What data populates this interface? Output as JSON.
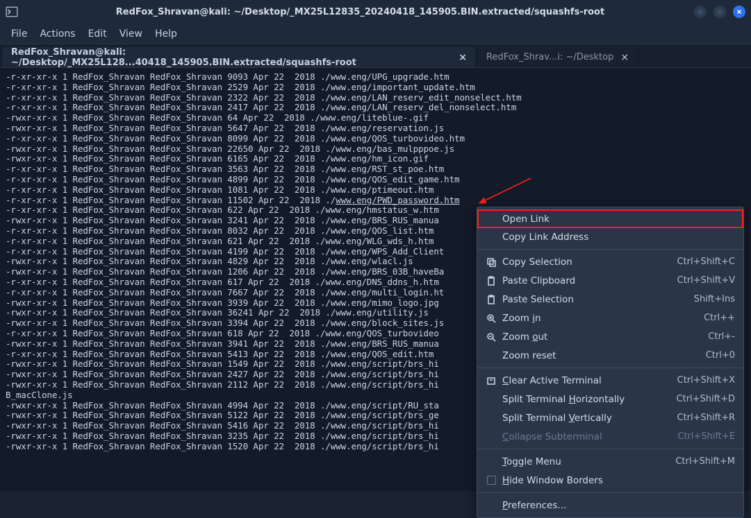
{
  "titlebar": {
    "title": "RedFox_Shravan@kali: ~/Desktop/_MX25L12835_20240418_145905.BIN.extracted/squashfs-root"
  },
  "menubar": {
    "file": "File",
    "actions": "Actions",
    "edit": "Edit",
    "view": "View",
    "help": "Help"
  },
  "tabs": [
    {
      "label": "RedFox_Shravan@kali: ~/Desktop/_MX25L128...40418_145905.BIN.extracted/squashfs-root",
      "active": true
    },
    {
      "label": "RedFox_Shrav...i: ~/Desktop",
      "active": false
    }
  ],
  "terminal_rows": [
    "-r-xr-xr-x 1 RedFox_Shravan RedFox_Shravan 9093 Apr 22  2018 ./www.eng/UPG_upgrade.htm",
    "-r-xr-xr-x 1 RedFox_Shravan RedFox_Shravan 2529 Apr 22  2018 ./www.eng/important_update.htm",
    "-r-xr-xr-x 1 RedFox_Shravan RedFox_Shravan 2322 Apr 22  2018 ./www.eng/LAN_reserv_edit_nonselect.htm",
    "-r-xr-xr-x 1 RedFox_Shravan RedFox_Shravan 2417 Apr 22  2018 ./www.eng/LAN_reserv_del_nonselect.htm",
    "-rwxr-xr-x 1 RedFox_Shravan RedFox_Shravan 64 Apr 22  2018 ./www.eng/liteblue-.gif",
    "-rwxr-xr-x 1 RedFox_Shravan RedFox_Shravan 5647 Apr 22  2018 ./www.eng/reservation.js",
    "-r-xr-xr-x 1 RedFox_Shravan RedFox_Shravan 8099 Apr 22  2018 ./www.eng/QOS_turbovideo.htm",
    "-rwxr-xr-x 1 RedFox_Shravan RedFox_Shravan 22650 Apr 22  2018 ./www.eng/bas_mulpppoe.js",
    "-rwxr-xr-x 1 RedFox_Shravan RedFox_Shravan 6165 Apr 22  2018 ./www.eng/hm_icon.gif",
    "-r-xr-xr-x 1 RedFox_Shravan RedFox_Shravan 3563 Apr 22  2018 ./www.eng/RST_st_poe.htm",
    "-r-xr-xr-x 1 RedFox_Shravan RedFox_Shravan 4899 Apr 22  2018 ./www.eng/QOS_edit_game.htm",
    "-r-xr-xr-x 1 RedFox_Shravan RedFox_Shravan 1081 Apr 22  2018 ./www.eng/ptimeout.htm",
    "-r-xr-xr-x 1 RedFox_Shravan RedFox_Shravan 11502 Apr 22  2018 ./|UNDER|www.eng/PWD_password.htm|END|",
    "-r-xr-xr-x 1 RedFox_Shravan RedFox_Shravan 622 Apr 22  2018 ./www.eng/hmstatus_w.htm",
    "-rwxr-xr-x 1 RedFox_Shravan RedFox_Shravan 3241 Apr 22  2018 ./www.eng/BRS_RUS_manua",
    "-r-xr-xr-x 1 RedFox_Shravan RedFox_Shravan 8032 Apr 22  2018 ./www.eng/QOS_list.htm",
    "-r-xr-xr-x 1 RedFox_Shravan RedFox_Shravan 621 Apr 22  2018 ./www.eng/WLG_wds_h.htm",
    "-r-xr-xr-x 1 RedFox_Shravan RedFox_Shravan 4199 Apr 22  2018 ./www.eng/WPS_Add_Client",
    "-rwxr-xr-x 1 RedFox_Shravan RedFox_Shravan 4829 Apr 22  2018 ./www.eng/wlacl.js",
    "-rwxr-xr-x 1 RedFox_Shravan RedFox_Shravan 1206 Apr 22  2018 ./www.eng/BRS_03B_haveBa",
    "-r-xr-xr-x 1 RedFox_Shravan RedFox_Shravan 617 Apr 22  2018 ./www.eng/DNS_ddns_h.htm",
    "-r-xr-xr-x 1 RedFox_Shravan RedFox_Shravan 7667 Apr 22  2018 ./www.eng/multi_login.ht",
    "-rwxr-xr-x 1 RedFox_Shravan RedFox_Shravan 3939 Apr 22  2018 ./www.eng/mimo_logo.jpg",
    "-rwxr-xr-x 1 RedFox_Shravan RedFox_Shravan 36241 Apr 22  2018 ./www.eng/utility.js",
    "-rwxr-xr-x 1 RedFox_Shravan RedFox_Shravan 3394 Apr 22  2018 ./www.eng/block_sites.js",
    "-r-xr-xr-x 1 RedFox_Shravan RedFox_Shravan 618 Apr 22  2018 ./www.eng/QOS_turbovideo",
    "-rwxr-xr-x 1 RedFox_Shravan RedFox_Shravan 3941 Apr 22  2018 ./www.eng/BRS_RUS_manua",
    "-r-xr-xr-x 1 RedFox_Shravan RedFox_Shravan 5413 Apr 22  2018 ./www.eng/QOS_edit.htm",
    "-rwxr-xr-x 1 RedFox_Shravan RedFox_Shravan 1549 Apr 22  2018 ./www.eng/script/brs_hi",
    "-rwxr-xr-x 1 RedFox_Shravan RedFox_Shravan 2427 Apr 22  2018 ./www.eng/script/brs_hi",
    "-rwxr-xr-x 1 RedFox_Shravan RedFox_Shravan 2112 Apr 22  2018 ./www.eng/script/brs_hi",
    "B_macClone.js",
    "-rwxr-xr-x 1 RedFox_Shravan RedFox_Shravan 4994 Apr 22  2018 ./www.eng/script/RU_sta",
    "-rwxr-xr-x 1 RedFox_Shravan RedFox_Shravan 5122 Apr 22  2018 ./www.eng/script/brs_ge",
    "-rwxr-xr-x 1 RedFox_Shravan RedFox_Shravan 5416 Apr 22  2018 ./www.eng/script/brs_hi",
    "-rwxr-xr-x 1 RedFox_Shravan RedFox_Shravan 3235 Apr 22  2018 ./www.eng/script/brs_hi",
    "-rwxr-xr-x 1 RedFox_Shravan RedFox_Shravan 1520 Apr 22  2018 ./www.eng/script/brs_hi"
  ],
  "context_menu": {
    "open_link": "Open Link",
    "copy_link_address": "Copy Link Address",
    "copy_selection": {
      "label": "Copy Selection",
      "shortcut": "Ctrl+Shift+C"
    },
    "paste_clipboard": {
      "label": "Paste Clipboard",
      "shortcut": "Ctrl+Shift+V"
    },
    "paste_selection": {
      "label": "Paste Selection",
      "shortcut": "Shift+Ins"
    },
    "zoom_in": {
      "label_pre": "Zoom ",
      "label_m": "i",
      "label_post": "n",
      "shortcut": "Ctrl++"
    },
    "zoom_out": {
      "label_pre": "Zoom ",
      "label_m": "o",
      "label_post": "ut",
      "shortcut": "Ctrl+-"
    },
    "zoom_reset": {
      "label": "Zoom reset",
      "shortcut": "Ctrl+0"
    },
    "clear_terminal": {
      "label_m": "C",
      "label_post": "lear Active Terminal",
      "shortcut": "Ctrl+Shift+X"
    },
    "split_h": {
      "label_pre": "Split Terminal ",
      "label_m": "H",
      "label_post": "orizontally",
      "shortcut": "Ctrl+Shift+D"
    },
    "split_v": {
      "label_pre": "Split Terminal ",
      "label_m": "V",
      "label_post": "ertically",
      "shortcut": "Ctrl+Shift+R"
    },
    "collapse": {
      "label_m": "C",
      "label_post": "ollapse Subterminal",
      "shortcut": "Ctrl+Shift+E"
    },
    "toggle_menu": {
      "label_m": "T",
      "label_post": "oggle Menu",
      "shortcut": "Ctrl+Shift+M"
    },
    "hide_borders": {
      "label_m": "H",
      "label_post": "ide Window Borders"
    },
    "preferences": {
      "label_m": "P",
      "label_post": "references..."
    }
  }
}
